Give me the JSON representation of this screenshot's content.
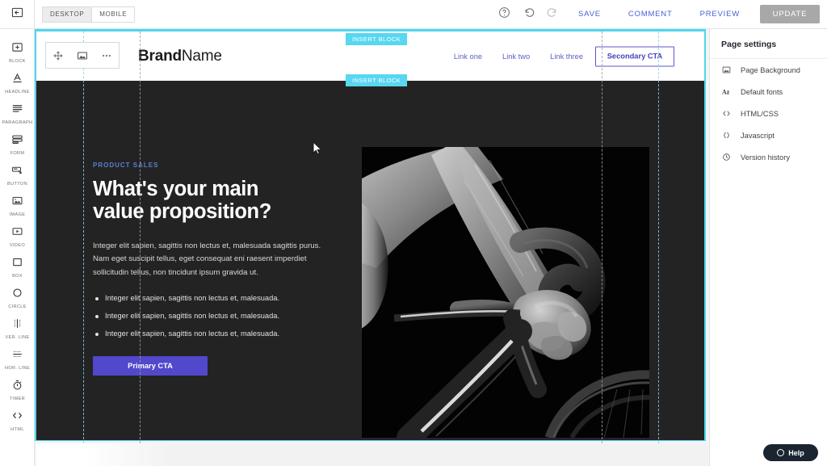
{
  "topbar": {
    "collapse_icon": "collapse-panel-icon",
    "devices": [
      {
        "label": "DESKTOP",
        "active": true
      },
      {
        "label": "MOBILE",
        "active": false
      }
    ],
    "icons": [
      {
        "name": "help-circle-icon"
      },
      {
        "name": "undo-icon"
      },
      {
        "name": "redo-icon"
      }
    ],
    "actions": [
      {
        "label": "SAVE"
      },
      {
        "label": "COMMENT"
      },
      {
        "label": "PREVIEW"
      }
    ],
    "update_label": "UPDATE",
    "action_color": "#4a5fd0",
    "update_bg": "#a8a8a8"
  },
  "left_rail": {
    "items": [
      {
        "label": "BLOCK",
        "icon": "block-icon"
      },
      {
        "label": "HEADLINE",
        "icon": "headline-icon"
      },
      {
        "label": "PARAGRAPH",
        "icon": "paragraph-icon"
      },
      {
        "label": "FORM",
        "icon": "form-icon"
      },
      {
        "label": "BUTTON",
        "icon": "button-icon"
      },
      {
        "label": "IMAGE",
        "icon": "image-icon"
      },
      {
        "label": "VIDEO",
        "icon": "video-icon"
      },
      {
        "label": "BOX",
        "icon": "box-icon"
      },
      {
        "label": "CIRCLE",
        "icon": "circle-icon"
      },
      {
        "label": "VER. LINE",
        "icon": "vertical-line-icon"
      },
      {
        "label": "HOR. LINE",
        "icon": "horizontal-line-icon"
      },
      {
        "label": "TIMER",
        "icon": "timer-icon"
      },
      {
        "label": "HTML",
        "icon": "html-code-icon"
      }
    ]
  },
  "right_panel": {
    "title": "Page settings",
    "items": [
      {
        "label": "Page Background",
        "icon": "picture-icon"
      },
      {
        "label": "Default fonts",
        "icon": "az-font-icon"
      },
      {
        "label": "HTML/CSS",
        "icon": "angle-brackets-icon"
      },
      {
        "label": "Javascript",
        "icon": "curly-braces-icon"
      },
      {
        "label": "Version history",
        "icon": "clock-history-icon"
      }
    ]
  },
  "canvas": {
    "selection_color": "#4ed6ee",
    "insert_badges": [
      {
        "label": "INSERT BLOCK"
      },
      {
        "label": "INSERT BLOCK"
      }
    ],
    "block_toolbar": [
      {
        "name": "move-handle-icon"
      },
      {
        "name": "image-block-icon"
      },
      {
        "name": "more-options-icon"
      }
    ],
    "site_header": {
      "brand_bold": "Brand",
      "brand_light": "Name",
      "nav": [
        {
          "label": "Link one"
        },
        {
          "label": "Link two"
        },
        {
          "label": "Link three"
        }
      ],
      "secondary_cta": "Secondary CTA",
      "cta_border_color": "#5b56c8"
    },
    "hero": {
      "background": "#232323",
      "eyebrow": "PRODUCT SALES",
      "eyebrow_color": "#5b7fd4",
      "title_line1": "What's your main",
      "title_line2": "value proposition?",
      "paragraph": "Integer elit sapien, sagittis non lectus et, malesuada sagittis purus. Nam eget suscipit tellus, eget consequat eni raesent imperdiet sollicitudin tellus, non tincidunt ipsum gravida ut.",
      "bullets": [
        "Integer elit sapien, sagittis non lectus et, malesuada.",
        "Integer elit sapien, sagittis non lectus et, malesuada.",
        "Integer elit sapien, sagittis non lectus et, malesuada."
      ],
      "primary_cta": "Primary CTA",
      "primary_cta_color": "#5148cc",
      "photo_alt": "cyclist-forearm-gripping-handlebars-black-and-white"
    }
  },
  "help_widget": {
    "label": "Help",
    "icon": "help-circle-icon"
  }
}
